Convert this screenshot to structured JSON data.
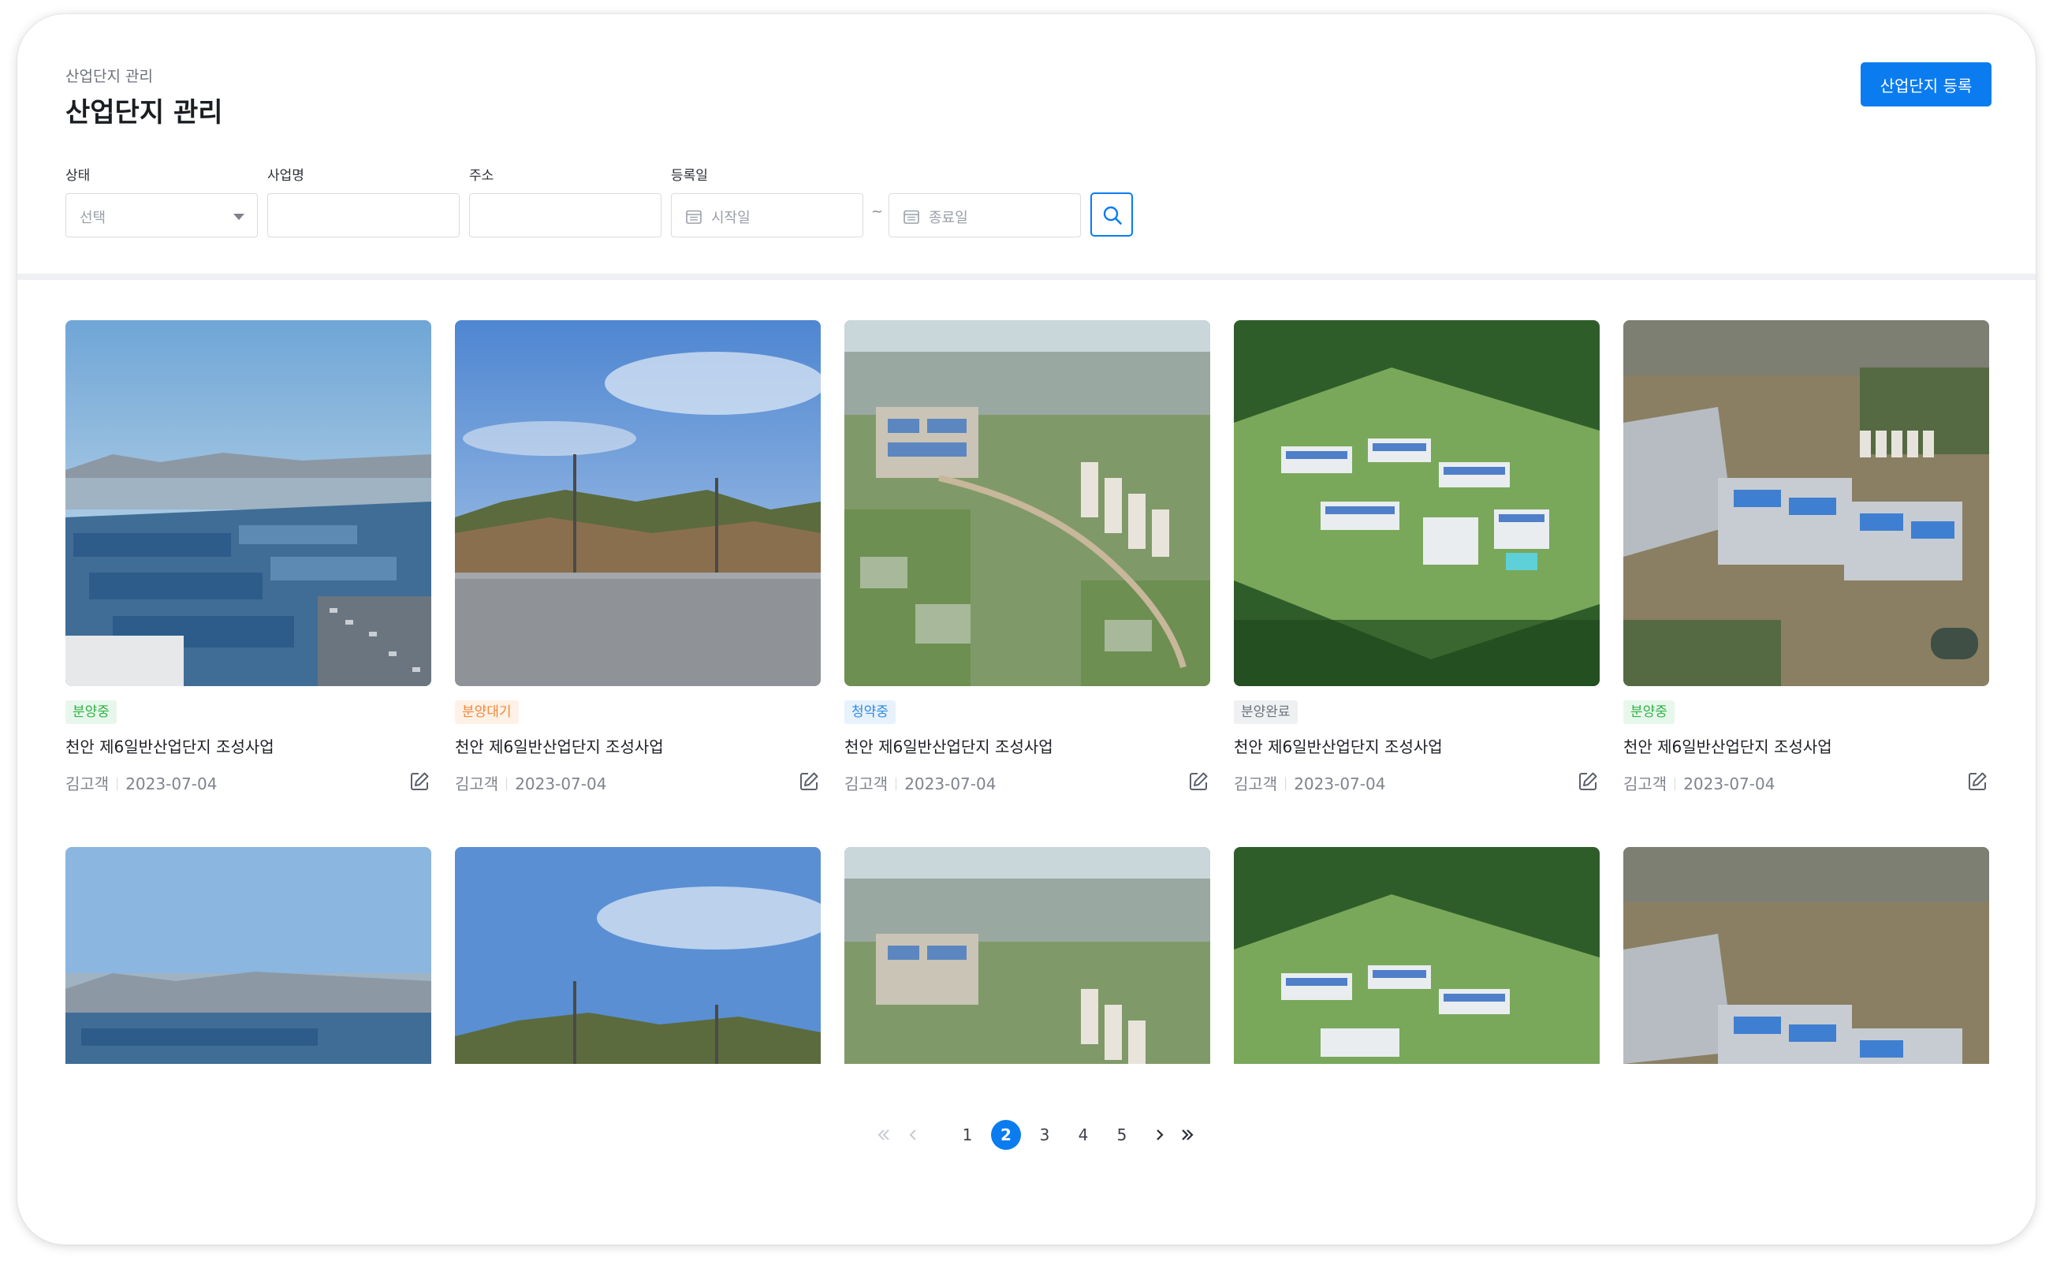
{
  "header": {
    "breadcrumb": "산업단지 관리",
    "title": "산업단지 관리",
    "register_label": "산업단지 등록"
  },
  "filters": {
    "status_label": "상태",
    "status_placeholder": "선택",
    "business_label": "사업명",
    "business_value": "",
    "address_label": "주소",
    "address_value": "",
    "date_label": "등록일",
    "start_placeholder": "시작일",
    "range_sep": "~",
    "end_placeholder": "종료일"
  },
  "cards": [
    {
      "status": "분양중",
      "status_color": "#2fb344",
      "status_bg": "#e8f7ec",
      "title": "천안 제6일반산업단지 조성사업",
      "author": "김고객",
      "date": "2023-07-04",
      "image": "factory-port"
    },
    {
      "status": "분양대기",
      "status_color": "#f0883e",
      "status_bg": "#fff1e5",
      "title": "천안 제6일반산업단지 조성사업",
      "author": "김고객",
      "date": "2023-07-04",
      "image": "roadside-hill"
    },
    {
      "status": "청약중",
      "status_color": "#2f8ae6",
      "status_bg": "#e7f2fd",
      "title": "천안 제6일반산업단지 조성사업",
      "author": "김고객",
      "date": "2023-07-04",
      "image": "aerial-town"
    },
    {
      "status": "분양완료",
      "status_color": "#6d737c",
      "status_bg": "#eef0f2",
      "title": "천안 제6일반산업단지 조성사업",
      "author": "김고객",
      "date": "2023-07-04",
      "image": "green-complex"
    },
    {
      "status": "분양중",
      "status_color": "#2fb344",
      "status_bg": "#e8f7ec",
      "title": "천안 제6일반산업단지 조성사업",
      "author": "김고객",
      "date": "2023-07-04",
      "image": "aerial-plant"
    },
    {
      "image": "factory-port"
    },
    {
      "image": "roadside-hill"
    },
    {
      "image": "aerial-town"
    },
    {
      "image": "green-complex"
    },
    {
      "image": "aerial-plant"
    }
  ],
  "pagination": {
    "pages": [
      "1",
      "2",
      "3",
      "4",
      "5"
    ],
    "current": "2"
  },
  "colors": {
    "primary": "#0a7cf0",
    "divider": "#eef0f3"
  }
}
